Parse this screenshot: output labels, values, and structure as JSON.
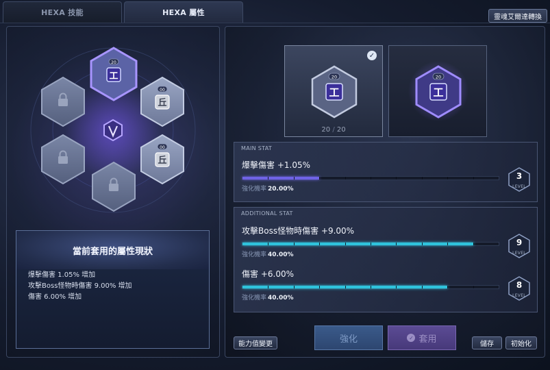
{
  "tabs": [
    {
      "label": "HEXA 技能",
      "active": false
    },
    {
      "label": "HEXA 屬性",
      "active": true
    }
  ],
  "convert_button": "靈魂艾爾達轉換",
  "nodes": [
    {
      "position": "top",
      "level": "20",
      "glyph": "工",
      "state": "selected"
    },
    {
      "position": "upper-right",
      "level": "00",
      "glyph": "丘",
      "state": "available"
    },
    {
      "position": "lower-right",
      "level": "00",
      "glyph": "丘",
      "state": "available"
    },
    {
      "position": "bottom",
      "state": "locked"
    },
    {
      "position": "lower-left",
      "state": "locked"
    },
    {
      "position": "upper-left",
      "state": "locked"
    }
  ],
  "center_emblem": "V",
  "summary": {
    "title": "當前套用的屬性現狀",
    "lines": [
      "爆擊傷害 1.05% 增加",
      "攻擊Boss怪物時傷害 9.00% 增加",
      "傷害 6.00% 增加"
    ]
  },
  "cards": [
    {
      "level": "20",
      "current": "20",
      "max": "20",
      "selected": true
    },
    {
      "level": "20",
      "selected": false
    }
  ],
  "main_stat": {
    "caption": "MAIN STAT",
    "name": "爆擊傷害 +1.05%",
    "progress": 0.3,
    "rate_label": "強化機率",
    "rate_value": "20.00%",
    "level": "3",
    "level_label": "LEVEL"
  },
  "additional_stat": {
    "caption": "ADDITIONAL STAT",
    "items": [
      {
        "name": "攻擊Boss怪物時傷害 +9.00%",
        "progress": 0.9,
        "rate_label": "強化機率",
        "rate_value": "40.00%",
        "level": "9",
        "level_label": "LEVEL"
      },
      {
        "name": "傷害 +6.00%",
        "progress": 0.8,
        "rate_label": "強化機率",
        "rate_value": "40.00%",
        "level": "8",
        "level_label": "LEVEL"
      }
    ]
  },
  "buttons": {
    "change_stat": "能力值變更",
    "enhance": "強化",
    "apply": "套用",
    "save": "儲存",
    "reset": "初始化"
  },
  "colors": {
    "main_bar": "#6f63e6",
    "additional_bar": "#2fc3dc",
    "selected_hex": "#8e7cf0"
  }
}
